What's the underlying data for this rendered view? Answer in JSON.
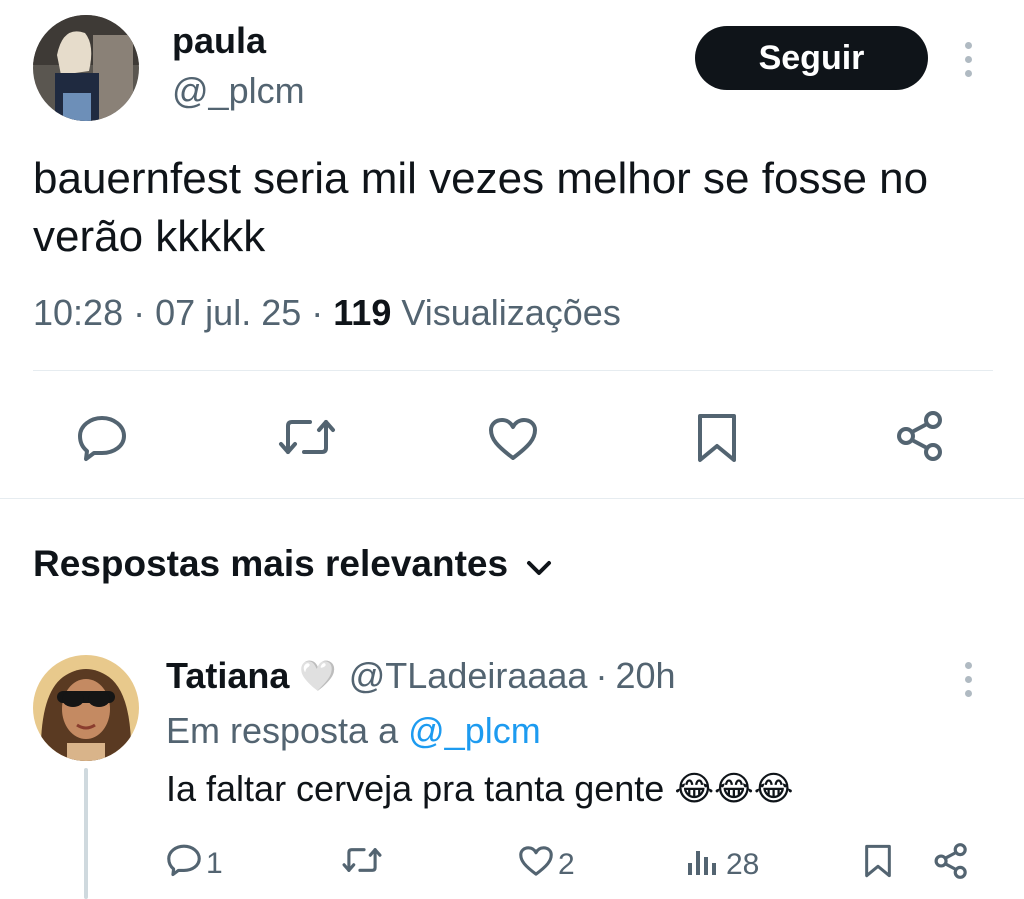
{
  "tweet": {
    "author_name": "paula",
    "author_handle": "@_plcm",
    "follow_label": "Seguir",
    "text": "bauernfest seria mil vezes melhor se fosse no verão kkkkk",
    "time": "10:28",
    "date": "07 jul. 25",
    "separator": "·",
    "views_count": "119",
    "views_label": "Visualizações",
    "actions": [
      "reply-icon",
      "retweet-icon",
      "like-icon",
      "bookmark-icon",
      "share-icon"
    ]
  },
  "replies_section": {
    "sort_label": "Respostas mais relevantes"
  },
  "reply": {
    "author_name": "Tatiana",
    "author_emoji": "🤍",
    "author_handle": "@TLadeiraaaa",
    "separator": "·",
    "time": "20h",
    "in_reply_prefix": "Em resposta a",
    "in_reply_handle": "@_plcm",
    "text": "Ia faltar cerveja pra tanta gente",
    "emojis": "😂😂😂",
    "stats": {
      "replies": "1",
      "retweets": "",
      "likes": "2",
      "views": "28"
    }
  },
  "colors": {
    "text": "#0f1419",
    "muted": "#536471",
    "link": "#1d9bf0",
    "button_bg": "#0f1419",
    "divider": "#e6ecf0"
  }
}
